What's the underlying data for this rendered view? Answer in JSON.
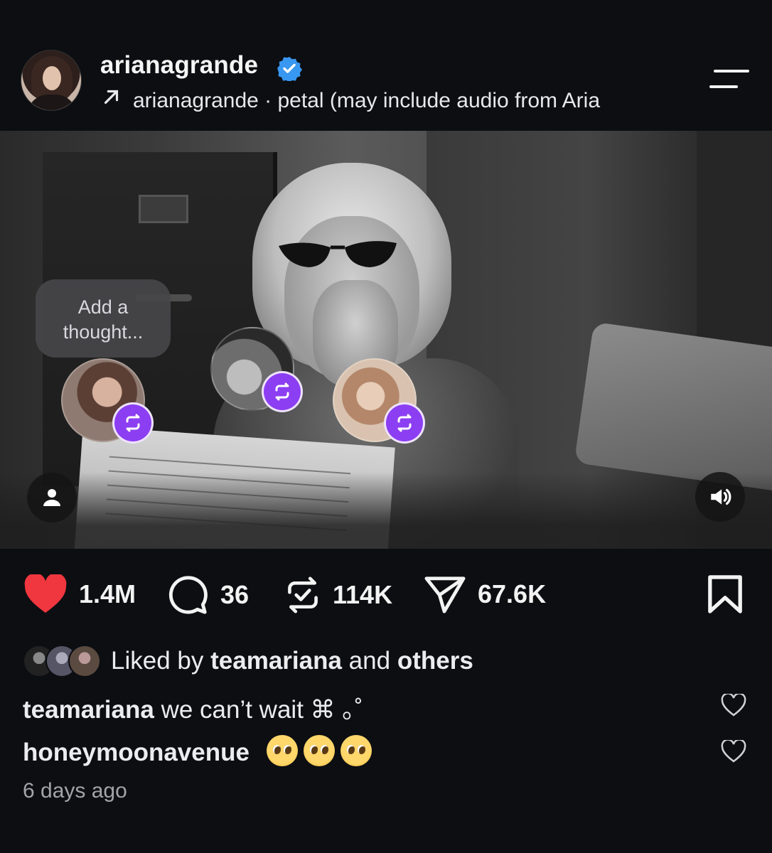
{
  "post": {
    "username": "arianagrande",
    "verified": true,
    "audio_line": "arianagrande · petal  (may include audio from Aria"
  },
  "media": {
    "thought_bubble": "Add a\nthought...",
    "repost_icon": "repost-icon",
    "profile_icon": "person-icon",
    "sound_icon": "speaker-icon"
  },
  "actions": {
    "likes": "1.4M",
    "comments": "36",
    "reposts": "114K",
    "shares": "67.6K",
    "like_color": "#f0363f"
  },
  "liked_by": {
    "prefix": "Liked by",
    "user": "teamariana",
    "conj": "and",
    "others": "others"
  },
  "comments": [
    {
      "user": "teamariana",
      "text": "we can’t wait ⌘ ｡˚"
    },
    {
      "user": "honeymoonavenue",
      "text": ""
    }
  ],
  "timestamp": "6 days ago",
  "colors": {
    "background": "#0c0e12",
    "verified": "#3897f0",
    "repost_badge": "#8c3ef2"
  }
}
